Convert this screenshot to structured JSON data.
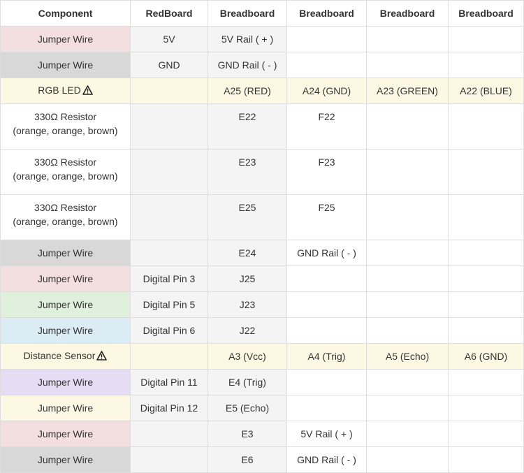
{
  "headers": [
    "Component",
    "RedBoard",
    "Breadboard",
    "Breadboard",
    "Breadboard",
    "Breadboard"
  ],
  "rows": [
    {
      "component": "Jumper Wire",
      "color": "#f4dfe0",
      "redboard": "5V",
      "bb1": "5V Rail ( + )",
      "bb2": "",
      "bb3": "",
      "bb4": ""
    },
    {
      "component": "Jumper Wire",
      "color": "#d8d8d8",
      "redboard": "GND",
      "bb1": "GND Rail ( - )",
      "bb2": "",
      "bb3": "",
      "bb4": ""
    },
    {
      "component": "RGB LED",
      "warning": true,
      "color": "#fdf8e4",
      "row_color": "#fdf8e4",
      "redboard": "",
      "bb1": "A25 (RED)",
      "bb2": "A24 (GND)",
      "bb3": "A23 (GREEN)",
      "bb4": "A22 (BLUE)"
    },
    {
      "component": "330Ω Resistor",
      "sub": "(orange, orange, brown)",
      "color": "#ffffff",
      "redboard": "",
      "bb1": "E22",
      "bb2": "F22",
      "bb3": "",
      "bb4": ""
    },
    {
      "component": "330Ω Resistor",
      "sub": "(orange, orange, brown)",
      "color": "#ffffff",
      "redboard": "",
      "bb1": "E23",
      "bb2": "F23",
      "bb3": "",
      "bb4": ""
    },
    {
      "component": "330Ω Resistor",
      "sub": "(orange, orange, brown)",
      "color": "#ffffff",
      "redboard": "",
      "bb1": "E25",
      "bb2": "F25",
      "bb3": "",
      "bb4": ""
    },
    {
      "component": "Jumper Wire",
      "color": "#d8d8d8",
      "redboard": "",
      "bb1": "E24",
      "bb2": "GND Rail ( - )",
      "bb3": "",
      "bb4": ""
    },
    {
      "component": "Jumper Wire",
      "color": "#f4dfe0",
      "redboard": "Digital Pin 3",
      "bb1": "J25",
      "bb2": "",
      "bb3": "",
      "bb4": ""
    },
    {
      "component": "Jumper Wire",
      "color": "#dff1dc",
      "redboard": "Digital Pin 5",
      "bb1": "J23",
      "bb2": "",
      "bb3": "",
      "bb4": ""
    },
    {
      "component": "Jumper Wire",
      "color": "#dcecf5",
      "redboard": "Digital Pin 6",
      "bb1": "J22",
      "bb2": "",
      "bb3": "",
      "bb4": ""
    },
    {
      "component": "Distance Sensor",
      "warning": true,
      "color": "#fdf8e4",
      "row_color": "#fdf8e4",
      "redboard": "",
      "bb1": "A3 (Vcc)",
      "bb2": "A4 (Trig)",
      "bb3": "A5 (Echo)",
      "bb4": "A6 (GND)"
    },
    {
      "component": "Jumper Wire",
      "color": "#e6dcf4",
      "redboard": "Digital Pin 11",
      "bb1": "E4 (Trig)",
      "bb2": "",
      "bb3": "",
      "bb4": ""
    },
    {
      "component": "Jumper Wire",
      "color": "#fdf8e4",
      "redboard": "Digital Pin 12",
      "bb1": "E5 (Echo)",
      "bb2": "",
      "bb3": "",
      "bb4": ""
    },
    {
      "component": "Jumper Wire",
      "color": "#f4dfe0",
      "redboard": "",
      "bb1": "E3",
      "bb2": "5V Rail ( + )",
      "bb3": "",
      "bb4": ""
    },
    {
      "component": "Jumper Wire",
      "color": "#d8d8d8",
      "redboard": "",
      "bb1": "E6",
      "bb2": "GND Rail ( - )",
      "bb3": "",
      "bb4": ""
    }
  ]
}
